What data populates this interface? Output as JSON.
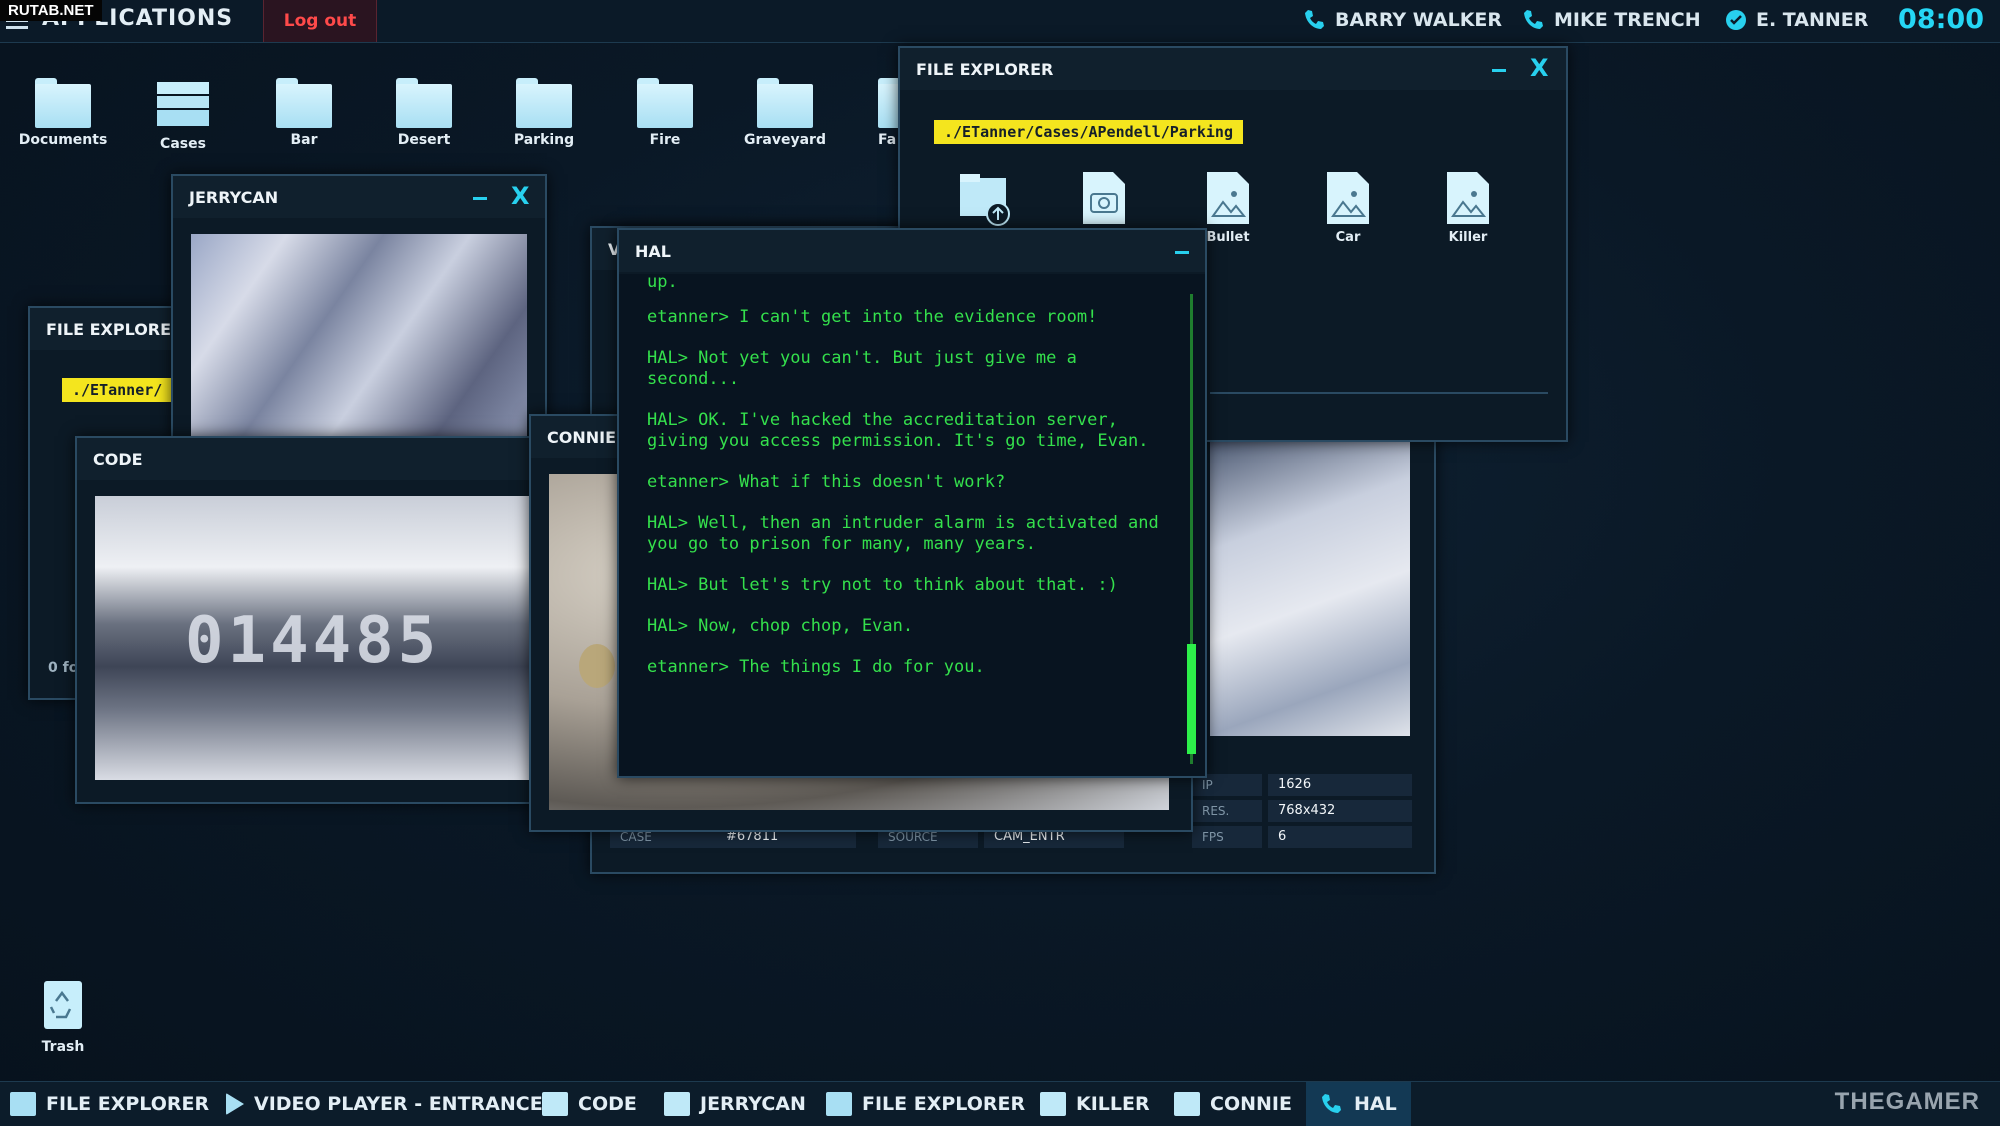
{
  "watermark": "RUTAB.NET",
  "topbar": {
    "apps_label": "APPLICATIONS",
    "logout_label": "Log out",
    "contacts": [
      "BARRY WALKER",
      "MIKE TRENCH",
      "E. TANNER"
    ],
    "clock": "08:00"
  },
  "desktop": {
    "icons": [
      "Documents",
      "Cases",
      "Bar",
      "Desert",
      "Parking",
      "Fire",
      "Graveyard",
      "Fa"
    ],
    "trash_label": "Trash"
  },
  "windows": {
    "jerrycan": {
      "title": "JERRYCAN"
    },
    "file_explorer_left": {
      "title": "FILE EXPLORER",
      "path": "./ETanner/",
      "status": "0 fo"
    },
    "code": {
      "title": "CODE",
      "plate_text": "014485"
    },
    "connie": {
      "title": "CONNIE"
    },
    "video_player": {
      "title": "V"
    },
    "file_explorer_main": {
      "title": "FILE EXPLORER",
      "path": "./ETanner/Cases/APendell/Parking",
      "files": [
        "",
        "",
        "Bullet",
        "Car",
        "Killer"
      ]
    },
    "hal": {
      "title": "HAL",
      "lines": [
        "up.",
        "etanner> I can't get into the evidence room!",
        "HAL> Not yet you can't. But just give me a second...",
        "HAL> OK. I've hacked the accreditation server, giving you access permission. It's go time, Evan.",
        "etanner> What if this doesn't work?",
        "HAL> Well, then an intruder alarm is activated and you go to prison for many, many years.",
        "HAL> But let's try not to think about that. :)",
        "HAL> Now, chop chop, Evan.",
        "etanner> The things I do for you."
      ]
    },
    "video_info": {
      "case_key": "CASE",
      "case_val": "#67811",
      "source_key": "SOURCE",
      "source_val": "CAM_ENTR",
      "ip_key": "IP",
      "ip_val": "1626",
      "res_key": "RES.",
      "res_val": "768x432",
      "fps_key": "FPS",
      "fps_val": "6"
    }
  },
  "taskbar": {
    "items": [
      "FILE EXPLORER",
      "VIDEO PLAYER - ENTRANCE",
      "CODE",
      "JERRYCAN",
      "FILE EXPLORER",
      "KILLER",
      "CONNIE",
      "HAL"
    ]
  },
  "brand": "THEGAMER",
  "colors": {
    "accent": "#28d0ee",
    "terminal": "#34e04c",
    "path_bg": "#f4e51e",
    "logout": "#ff4a4a"
  }
}
